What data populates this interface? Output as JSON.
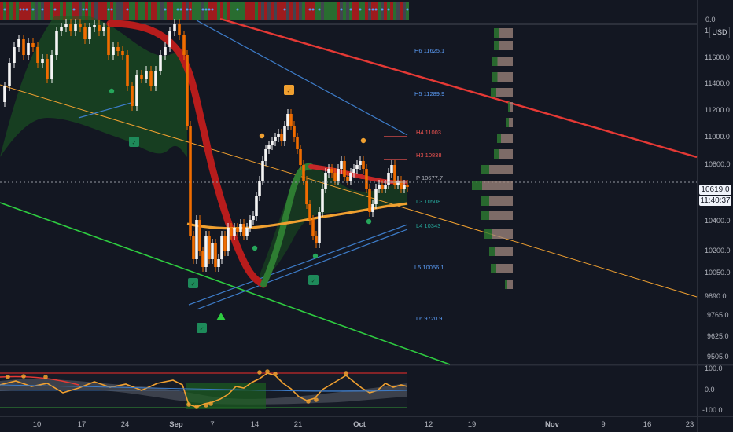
{
  "chart_data": {
    "type": "line",
    "price_axis": {
      "currency": "USD",
      "ticks": [
        "11800.0",
        "11600.0",
        "11400.0",
        "11200.0",
        "11000.0",
        "10800.0",
        "10600.0",
        "10400.0",
        "10200.0",
        "10050.0",
        "9890.0",
        "9765.0",
        "9625.0",
        "9505.0"
      ],
      "top_value": "0.0"
    },
    "oscillator_axis": {
      "ticks": [
        "100.0",
        "0.0",
        "-100.0"
      ]
    },
    "time_axis": {
      "ticks": [
        "10",
        "17",
        "24",
        "Sep",
        "7",
        "14",
        "21",
        "Oct",
        "12",
        "19",
        "Nov",
        "9",
        "16",
        "23"
      ]
    },
    "current_price": "10619.0",
    "countdown": "11:40:37",
    "pivot_levels": [
      {
        "label": "H6 11625.1",
        "color": "#5b9cf6"
      },
      {
        "label": "H5 11289.9",
        "color": "#5b9cf6"
      },
      {
        "label": "H4 11003",
        "color": "#ef5350"
      },
      {
        "label": "H3 10838",
        "color": "#ef5350"
      },
      {
        "label": "P 10677.7",
        "color": "#b2b5be"
      },
      {
        "label": "L3 10508",
        "color": "#26a69a"
      },
      {
        "label": "L4 10343",
        "color": "#26a69a"
      },
      {
        "label": "L5 10056.1",
        "color": "#5b9cf6"
      },
      {
        "label": "L6 9720.9",
        "color": "#5b9cf6"
      }
    ]
  },
  "colors": {
    "background": "#131722",
    "up": "#f5f5f5",
    "down": "#ef6c00",
    "ribbon_red": "#b71c1c",
    "ribbon_green": "#2e7d32",
    "channel_blue": "#3d7cc9",
    "trend_red": "#e53935",
    "trend_green": "#2ecc40",
    "ma_orange": "#f0a030",
    "tag_price": "#f0f3fa",
    "tag_time": "#f0f3fa"
  },
  "icons": [
    "triangle-up-icon",
    "circle-marker-icon",
    "label-marker-icon"
  ]
}
